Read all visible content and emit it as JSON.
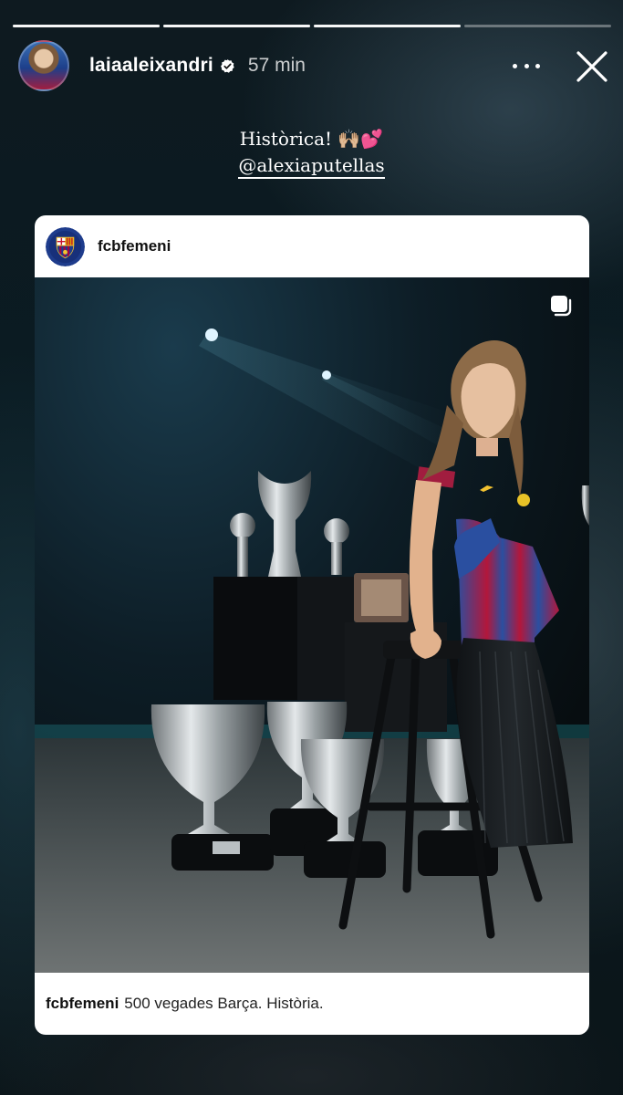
{
  "story": {
    "progress": [
      1,
      1,
      1,
      0
    ],
    "username": "laiaaleixandri",
    "time": "57 min",
    "avatar": "user-avatar",
    "icons": {
      "verified": "verified-badge-icon",
      "more": "more-options-icon",
      "close": "close-icon"
    }
  },
  "caption": {
    "text": "Històrica! 🙌🏼💕",
    "mention": "@alexiaputellas"
  },
  "post": {
    "account": "fcbfemeni",
    "logo": "fc-barcelona-crest",
    "image": "player-with-trophies-photo",
    "caption_user": "fcbfemeni",
    "caption_text": "500 vegades Barça. Història.",
    "multi_icon": "carousel-icon"
  },
  "colors": {
    "blaugrana_blue": "#1f4fa3",
    "blaugrana_red": "#b3173b",
    "gold": "#e8c227"
  }
}
